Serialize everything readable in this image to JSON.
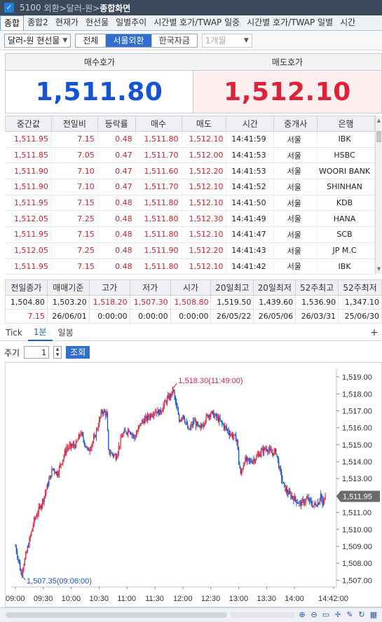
{
  "window": {
    "checkbox_mark": "✓",
    "code": "5100",
    "path": "외환>달러-원>",
    "current": "종합화면"
  },
  "tabs": [
    "종합",
    "종합2",
    "현재가",
    "현선물",
    "일별추이",
    "시간별 호가/TWAP 일중",
    "시간별 호가/TWAP 일별",
    "시간"
  ],
  "toolbar": {
    "instrument": "달러-원 현선물",
    "segments": [
      "전체",
      "서울외환",
      "한국자금"
    ],
    "active_segment": 1,
    "period_select": "1개월"
  },
  "quote": {
    "bid_label": "매수호가",
    "bid_value": "1,511.80",
    "ask_label": "매도호가",
    "ask_value": "1,512.10"
  },
  "ticks": {
    "headers": [
      "중간값",
      "전일비",
      "등락률",
      "매수",
      "매도",
      "시간",
      "중개사",
      "은행"
    ],
    "rows": [
      [
        "1,511.95",
        "7.15",
        "0.48",
        "1,511.80",
        "1,512.10",
        "14:41:59",
        "서울",
        "IBK"
      ],
      [
        "1,511.85",
        "7.05",
        "0.47",
        "1,511.70",
        "1,512.00",
        "14:41:53",
        "서울",
        "HSBC"
      ],
      [
        "1,511.90",
        "7.10",
        "0.47",
        "1,511.60",
        "1,512.20",
        "14:41:53",
        "서울",
        "WOORI BANK"
      ],
      [
        "1,511.90",
        "7.10",
        "0.47",
        "1,511.70",
        "1,512.10",
        "14:41:52",
        "서울",
        "SHINHAN"
      ],
      [
        "1,511.95",
        "7.15",
        "0.48",
        "1,511.80",
        "1,512.10",
        "14:41:50",
        "서울",
        "KDB"
      ],
      [
        "1,512.05",
        "7.25",
        "0.48",
        "1,511.80",
        "1,512.30",
        "14:41:49",
        "서울",
        "HANA"
      ],
      [
        "1,511.95",
        "7.15",
        "0.48",
        "1,511.80",
        "1,512.10",
        "14:41:47",
        "서울",
        "SCB"
      ],
      [
        "1,512.05",
        "7.25",
        "0.48",
        "1,511.90",
        "1,512.20",
        "14:41:43",
        "서울",
        "JP M.C"
      ],
      [
        "1,511.95",
        "7.15",
        "0.48",
        "1,511.80",
        "1,512.10",
        "14:41:42",
        "서울",
        "IBK"
      ]
    ]
  },
  "summary": {
    "headers": [
      "전일종가",
      "매매기준",
      "고가",
      "저가",
      "시가",
      "20일최고",
      "20일최저",
      "52주최고",
      "52주최저"
    ],
    "row1": [
      "1,504.80",
      "1,503.20",
      "1,518.20",
      "1,507.30",
      "1,508.80",
      "1,519.50",
      "1,439.60",
      "1,536.90",
      "1,347.10"
    ],
    "row2": [
      "7.15",
      "26/06/01",
      "0:00:00",
      "0:00:00",
      "0:00:00",
      "26/05/22",
      "26/05/06",
      "26/03/31",
      "25/06/30"
    ]
  },
  "chart_tabs": [
    "Tick",
    "1분",
    "일봉"
  ],
  "active_chart_tab": 1,
  "period": {
    "label": "주기",
    "value": "1",
    "button": "조회"
  },
  "chart_data": {
    "type": "candlestick",
    "y_ticks": [
      "1,519.00",
      "1,518.00",
      "1,517.00",
      "1,516.00",
      "1,515.00",
      "1,514.00",
      "1,513.00",
      "1,512.00",
      "1,511.00",
      "1,510.00",
      "1,509.00",
      "1,508.00",
      "1,507.00"
    ],
    "ylim": [
      1506.6,
      1519.5
    ],
    "x_ticks": [
      "09:00",
      "09:30",
      "10:00",
      "10:30",
      "11:00",
      "11:30",
      "12:00",
      "12:30",
      "13:00",
      "13:30",
      "14:00",
      "14:42:00"
    ],
    "high_annotation": "1,518.30(11:49:00)",
    "low_annotation": "1,507.35(09:06:00)",
    "current_label": "1,511.95",
    "path": [
      [
        0,
        1509.0
      ],
      [
        4,
        1508.0
      ],
      [
        6,
        1507.35
      ],
      [
        10,
        1508.2
      ],
      [
        20,
        1510.5
      ],
      [
        30,
        1511.8
      ],
      [
        40,
        1513.6
      ],
      [
        45,
        1513.3
      ],
      [
        55,
        1514.8
      ],
      [
        65,
        1515.0
      ],
      [
        70,
        1515.7
      ],
      [
        78,
        1514.6
      ],
      [
        85,
        1515.4
      ],
      [
        93,
        1517.0
      ],
      [
        98,
        1516.8
      ],
      [
        100,
        1514.6
      ],
      [
        108,
        1514.3
      ],
      [
        115,
        1515.6
      ],
      [
        122,
        1515.9
      ],
      [
        128,
        1515.4
      ],
      [
        135,
        1516.3
      ],
      [
        142,
        1516.6
      ],
      [
        150,
        1517.0
      ],
      [
        155,
        1516.9
      ],
      [
        162,
        1517.6
      ],
      [
        168,
        1518.0
      ],
      [
        169,
        1518.3
      ],
      [
        172,
        1517.5
      ],
      [
        176,
        1516.4
      ],
      [
        180,
        1516.8
      ],
      [
        186,
        1515.8
      ],
      [
        192,
        1516.4
      ],
      [
        198,
        1515.9
      ],
      [
        205,
        1516.6
      ],
      [
        210,
        1516.9
      ],
      [
        218,
        1516.5
      ],
      [
        224,
        1516.1
      ],
      [
        230,
        1515.7
      ],
      [
        234,
        1515.5
      ],
      [
        238,
        1515.3
      ],
      [
        240,
        1514.0
      ],
      [
        242,
        1513.2
      ],
      [
        246,
        1514.1
      ],
      [
        252,
        1514.0
      ],
      [
        258,
        1514.2
      ],
      [
        264,
        1514.6
      ],
      [
        270,
        1514.8
      ],
      [
        275,
        1514.5
      ],
      [
        280,
        1514.6
      ],
      [
        284,
        1513.5
      ],
      [
        288,
        1512.6
      ],
      [
        292,
        1512.2
      ],
      [
        298,
        1511.9
      ],
      [
        306,
        1511.5
      ],
      [
        314,
        1511.8
      ],
      [
        320,
        1511.4
      ],
      [
        326,
        1511.6
      ],
      [
        328,
        1512.2
      ],
      [
        330,
        1511.4
      ],
      [
        333,
        1511.95
      ]
    ]
  }
}
